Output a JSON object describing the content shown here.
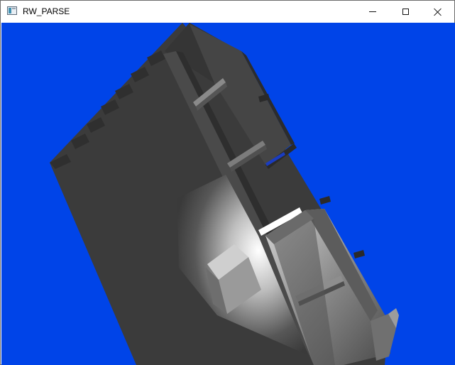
{
  "window": {
    "title": "RW_PARSE",
    "buttons": {
      "minimize": "minimize",
      "maximize": "maximize",
      "close": "close"
    }
  },
  "colors": {
    "viewport_background": "#0044e8",
    "model_dark": "#3a3a3a",
    "model_mid": "#5a5a5a",
    "model_light": "#f4f4f4"
  }
}
